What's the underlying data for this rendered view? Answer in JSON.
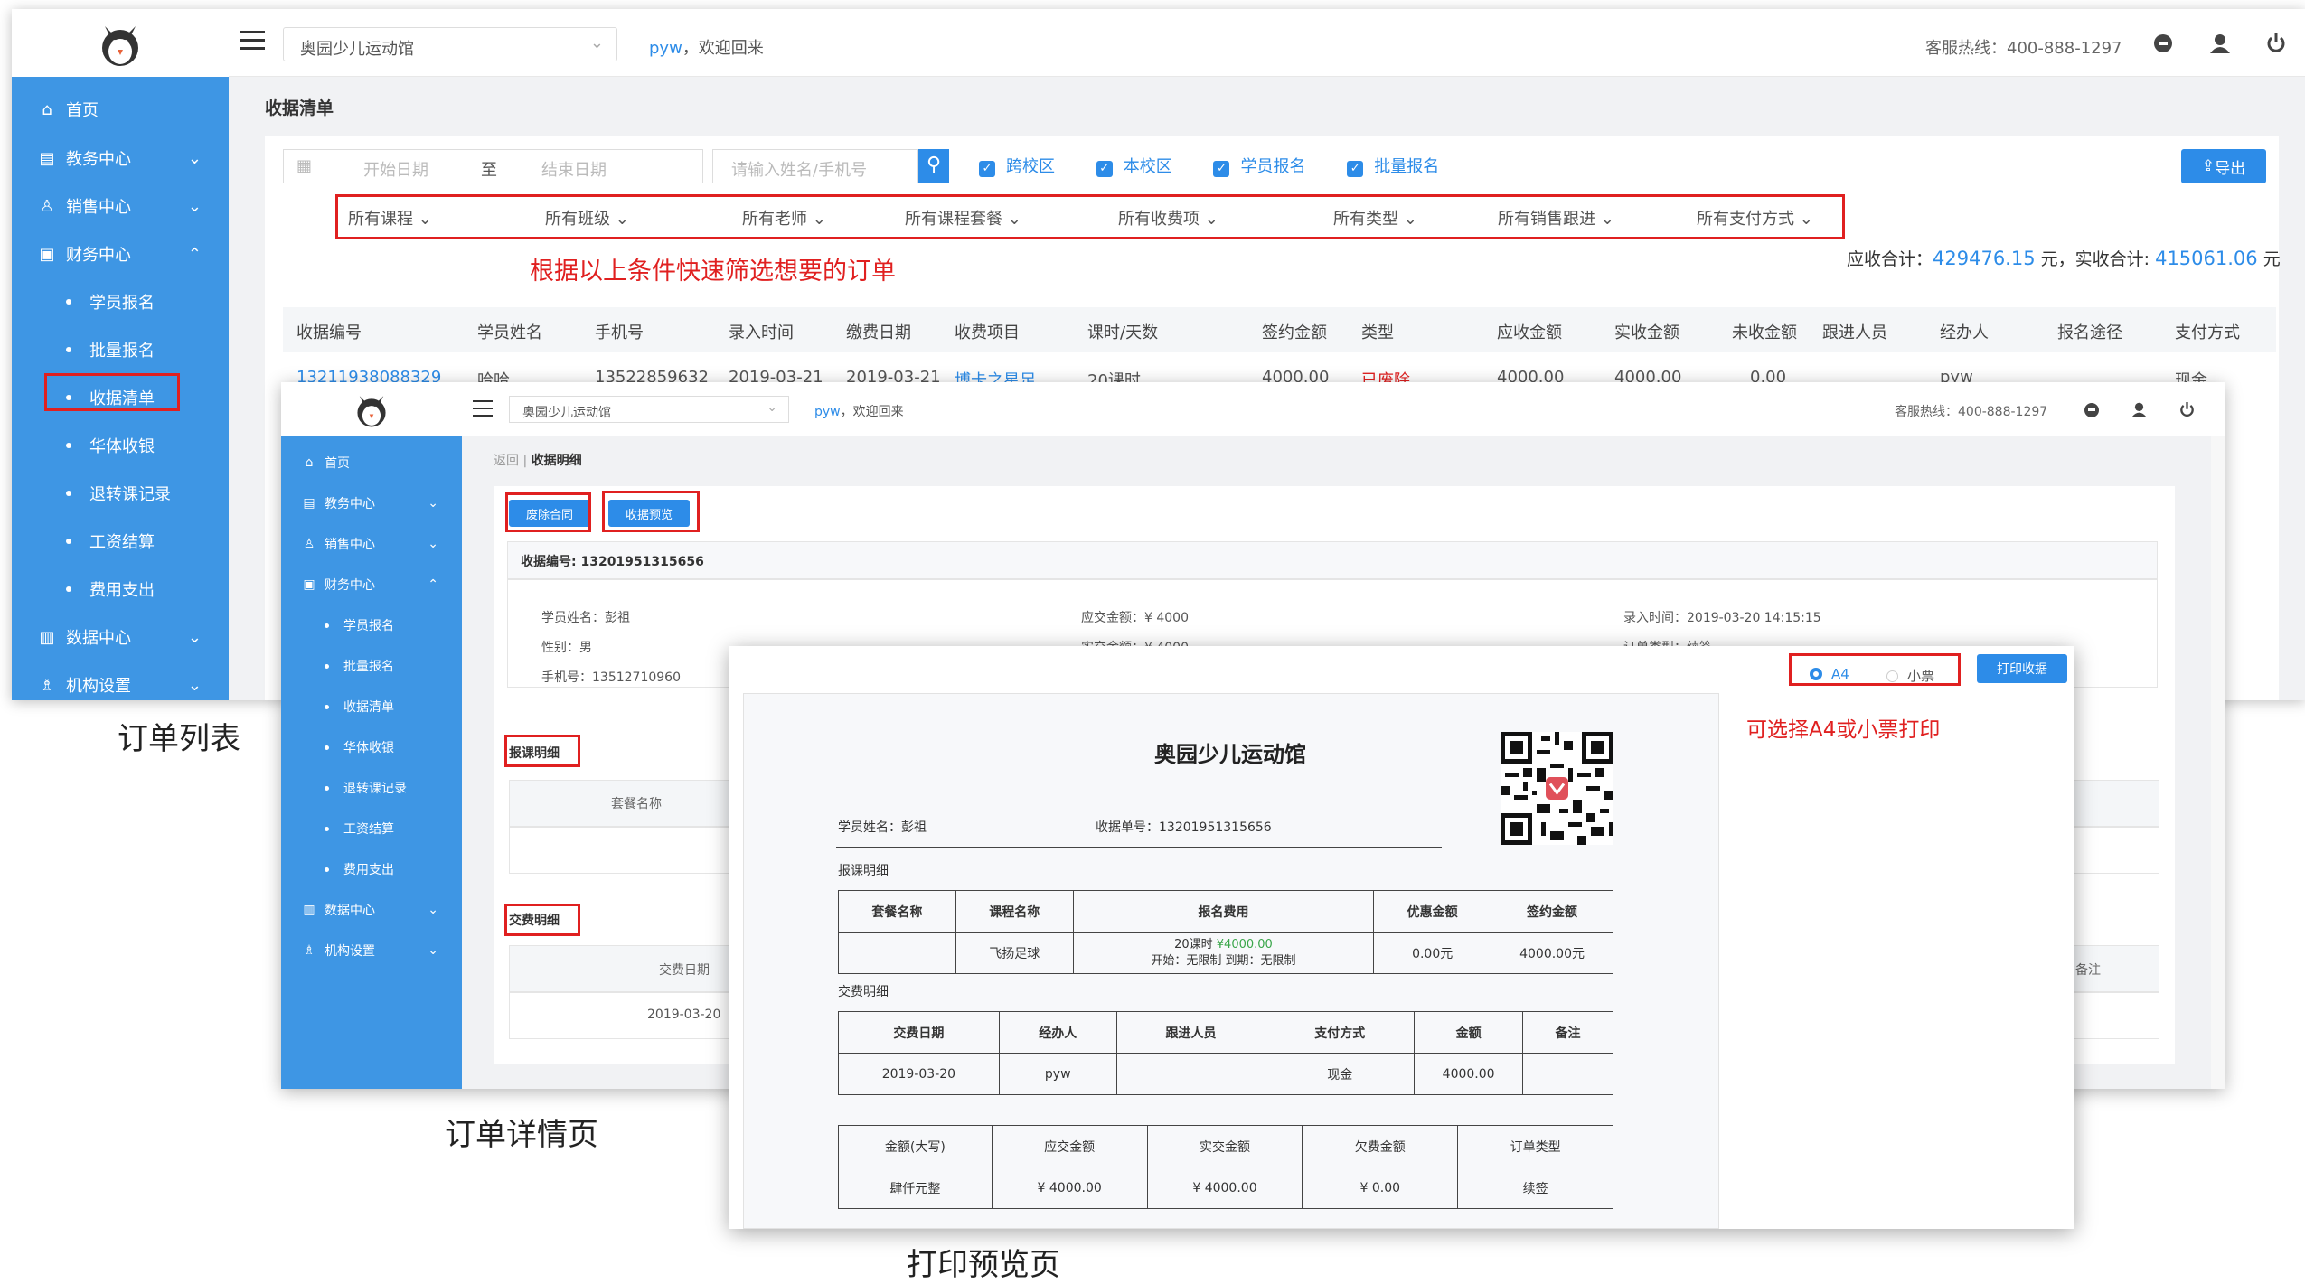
{
  "list_page": {
    "caption": "订单列表",
    "header": {
      "school": "奥园少儿运动馆",
      "user": "pyw",
      "welcome": "，欢迎回来",
      "hotline": "客服热线：400-888-1297"
    },
    "menu": [
      {
        "label": "首页",
        "icon": "home-icon"
      },
      {
        "label": "教务中心",
        "icon": "book-icon"
      },
      {
        "label": "销售中心",
        "icon": "user-icon"
      },
      {
        "label": "财务中心",
        "icon": "wallet-icon"
      }
    ],
    "submenu": [
      "学员报名",
      "批量报名",
      "收据清单",
      "华体收银",
      "退转课记录",
      "工资结算",
      "费用支出"
    ],
    "menu_bottom": [
      {
        "label": "数据中心",
        "icon": "chart-icon"
      },
      {
        "label": "机构设置",
        "icon": "org-icon"
      }
    ],
    "page_title": "收据清单",
    "date_start_placeholder": "开始日期",
    "date_sep": "至",
    "date_end_placeholder": "结束日期",
    "search_placeholder": "请输入姓名/手机号",
    "checks": [
      "跨校区",
      "本校区",
      "学员报名",
      "批量报名"
    ],
    "export": "导出",
    "filters": [
      "所有课程",
      "所有班级",
      "所有老师",
      "所有课程套餐",
      "所有收费项",
      "所有类型",
      "所有销售跟进",
      "所有支付方式"
    ],
    "annotation": "根据以上条件快速筛选想要的订单",
    "totals_label1": "应收合计：",
    "totals_value1": "429476.15",
    "totals_unit1": "元，实收合计:",
    "totals_value2": "415061.06",
    "totals_unit2": "元",
    "columns": [
      "收据编号",
      "学员姓名",
      "手机号",
      "录入时间",
      "缴费日期",
      "收费项目",
      "课时/天数",
      "签约金额",
      "类型",
      "应收金额",
      "实收金额",
      "未收金额",
      "跟进人员",
      "经办人",
      "报名途径",
      "支付方式"
    ],
    "row": [
      "13211938088329",
      "哈哈",
      "13522859632",
      "2019-03-21",
      "2019-03-21",
      "博卡之星足...",
      "20课时",
      "4000.00",
      "已废除",
      "4000.00",
      "4000.00",
      "0.00",
      "",
      "pyw",
      "",
      "现金"
    ]
  },
  "detail_page": {
    "caption": "订单详情页",
    "header": {
      "school": "奥园少儿运动馆",
      "user": "pyw",
      "welcome": "，欢迎回来",
      "hotline": "客服热线：400-888-1297"
    },
    "breadcrumb_back": "返回",
    "breadcrumb_current": "收据明细",
    "btn_cancel": "废除合同",
    "btn_preview": "收据预览",
    "receipt_no_label": "收据编号: 13201951315656",
    "student": "学员姓名：彭祖",
    "gender": "性别：男",
    "phone": "手机号：13512710960",
    "due": "应交金额：¥ 4000",
    "paid": "实交金额：¥ 4000",
    "entry_time": "录入时间：2019-03-20 14:15:15",
    "order_type": "订单类型：续签",
    "section_course": "报课明细",
    "col_package": "套餐名称",
    "section_pay": "交费明细",
    "col_pay_date": "交费日期",
    "pay_date": "2019-03-20",
    "col_note": "备注"
  },
  "print_page": {
    "caption": "打印预览页",
    "opt_a4": "A4",
    "opt_ticket": "小票",
    "btn_print": "打印收据",
    "annotation": "可选择A4或小票打印",
    "title": "奥园少儿运动馆",
    "student": "学员姓名：彭祖",
    "receipt_no": "收据单号：13201951315656",
    "course_section": "报课明细",
    "course_cols": [
      "套餐名称",
      "课程名称",
      "报名费用",
      "优惠金额",
      "签约金额"
    ],
    "course_row": {
      "package": "",
      "course": "飞扬足球",
      "fee_line1": "20课时",
      "fee_price": "¥4000.00",
      "fee_line2": "开始：无限制 到期：无限制",
      "discount": "0.00元",
      "signed": "4000.00元"
    },
    "pay_section": "交费明细",
    "pay_cols": [
      "交费日期",
      "经办人",
      "跟进人员",
      "支付方式",
      "金额",
      "备注"
    ],
    "pay_row": [
      "2019-03-20",
      "pyw",
      "",
      "现金",
      "4000.00",
      ""
    ],
    "sum_cols": [
      "金额(大写)",
      "应交金额",
      "实交金额",
      "欠费金额",
      "订单类型"
    ],
    "sum_row": [
      "肆仟元整",
      "¥ 4000.00",
      "¥ 4000.00",
      "¥ 0.00",
      "续签"
    ]
  }
}
